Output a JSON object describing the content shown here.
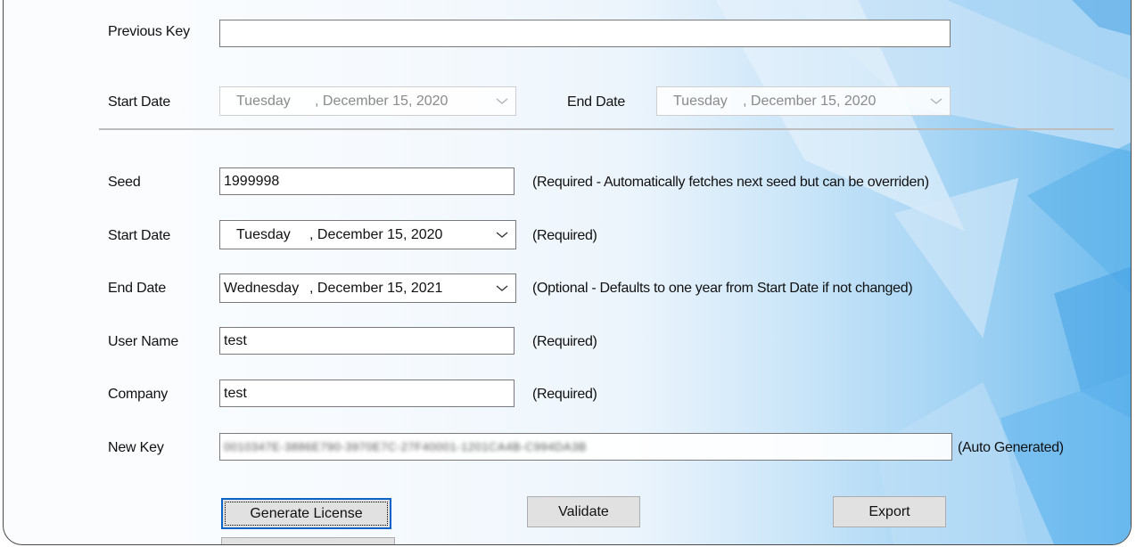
{
  "previous_key": {
    "label": "Previous Key",
    "value": ""
  },
  "range": {
    "start_label": "Start Date",
    "start_day": "Tuesday",
    "start_date": ", December 15, 2020",
    "end_label": "End Date",
    "end_day": "Tuesday",
    "end_date": ", December 15, 2020"
  },
  "form": {
    "seed": {
      "label": "Seed",
      "value": "1999998",
      "hint": "(Required - Automatically fetches next seed but can be overriden)"
    },
    "start_date": {
      "label": "Start Date",
      "day": "Tuesday",
      "date": ", December 15, 2020",
      "hint": "(Required)"
    },
    "end_date": {
      "label": "End Date",
      "day": "Wednesday",
      "date": ", December 15, 2021",
      "hint": "(Optional - Defaults to one year from Start Date if not changed)"
    },
    "user_name": {
      "label": "User Name",
      "value": "test",
      "hint": "(Required)"
    },
    "company": {
      "label": "Company",
      "value": "test",
      "hint": "(Required)"
    },
    "new_key": {
      "label": "New Key",
      "value": "0010347E-3886E790-3970E7C-27F40001-1201CA4B-C994DA3B",
      "hint": "(Auto Generated)"
    }
  },
  "buttons": {
    "generate": "Generate License",
    "validate": "Validate",
    "export": "Export"
  },
  "icons": {
    "dropdown": "chevron-down-icon"
  },
  "colors": {
    "focus_border": "#0a64c8",
    "button_face": "#e1e1e1",
    "separator": "#bdbdbd"
  }
}
